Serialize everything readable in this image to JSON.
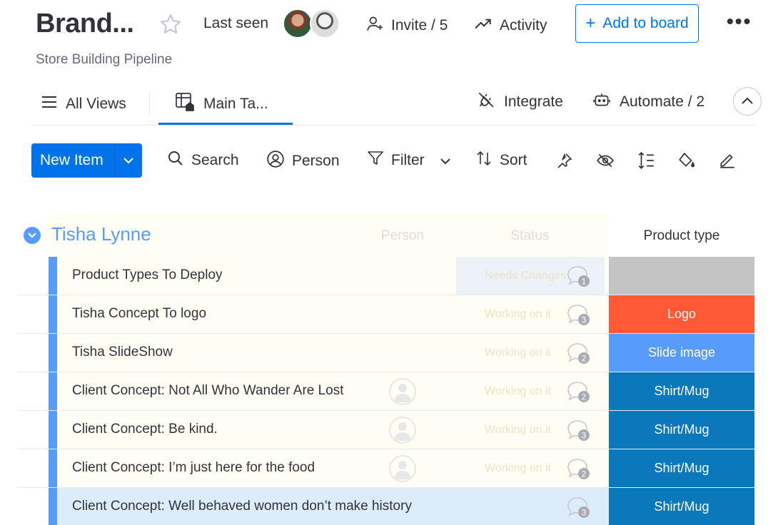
{
  "header": {
    "title": "Brand...",
    "subtitle": "Store Building Pipeline",
    "last_seen_label": "Last seen",
    "invite_label": "Invite / 5",
    "activity_label": "Activity",
    "add_to_board_label": "Add to board",
    "more_label": "•••"
  },
  "views": {
    "all_views_label": "All Views",
    "main_tab_label": "Main Ta...",
    "integrate_label": "Integrate",
    "automate_label": "Automate / 2"
  },
  "toolbar": {
    "new_item_label": "New Item",
    "search_label": "Search",
    "person_label": "Person",
    "filter_label": "Filter",
    "sort_label": "Sort"
  },
  "group": {
    "title": "Tisha Lynne",
    "columns": {
      "person": "Person",
      "status": "Status",
      "product_type": "Product type"
    },
    "rows": [
      {
        "name": "Product Types To Deploy",
        "status": "Needs Changes",
        "updates": "1",
        "product_type": "",
        "type_color": "#c4c4c4"
      },
      {
        "name": "Tisha Concept To logo",
        "status": "Working on it",
        "updates": "3",
        "product_type": "Logo",
        "type_color": "#ff5a35"
      },
      {
        "name": "Tisha SlideShow",
        "status": "Working on it",
        "updates": "2",
        "product_type": "Slide image",
        "type_color": "#579bfc"
      },
      {
        "name": "Client Concept: Not All Who Wander Are Lost",
        "status": "Working on it",
        "updates": "2",
        "product_type": "Shirt/Mug",
        "type_color": "#0b78bb"
      },
      {
        "name": "Client Concept: Be kind.",
        "status": "Working on it",
        "updates": "3",
        "product_type": "Shirt/Mug",
        "type_color": "#0b78bb"
      },
      {
        "name": "Client Concept: I’m just here for the food",
        "status": "Working on it",
        "updates": "2",
        "product_type": "Shirt/Mug",
        "type_color": "#0b78bb"
      },
      {
        "name": "Client Concept: Well behaved women don’t make history",
        "status": "",
        "updates": "3",
        "product_type": "Shirt/Mug",
        "type_color": "#0b78bb"
      }
    ]
  },
  "colors": {
    "accent": "#0073ea",
    "group": "#579bfc"
  }
}
